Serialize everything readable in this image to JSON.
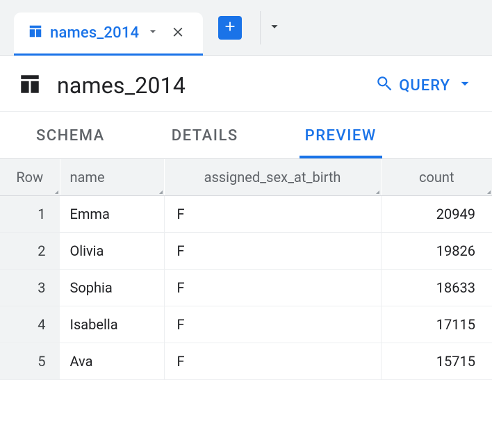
{
  "tab": {
    "title": "names_2014"
  },
  "header": {
    "title": "names_2014"
  },
  "query_btn": "QUERY",
  "sec_tabs": {
    "schema": "SCHEMA",
    "details": "DETAILS",
    "preview": "PREVIEW"
  },
  "columns": {
    "row": "Row",
    "name": "name",
    "sex": "assigned_sex_at_birth",
    "count": "count"
  },
  "rows": [
    {
      "row": "1",
      "name": "Emma",
      "sex": "F",
      "count": "20949"
    },
    {
      "row": "2",
      "name": "Olivia",
      "sex": "F",
      "count": "19826"
    },
    {
      "row": "3",
      "name": "Sophia",
      "sex": "F",
      "count": "18633"
    },
    {
      "row": "4",
      "name": "Isabella",
      "sex": "F",
      "count": "17115"
    },
    {
      "row": "5",
      "name": "Ava",
      "sex": "F",
      "count": "15715"
    }
  ]
}
